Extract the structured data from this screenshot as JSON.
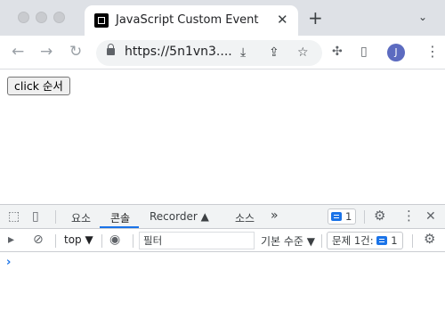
{
  "browser": {
    "tab": {
      "title": "JavaScript Custom Event",
      "close_glyph": "✕",
      "favicon": "page-favicon-icon"
    },
    "new_tab_glyph": "+",
    "tab_menu_glyph": "⌄",
    "toolbar": {
      "back_glyph": "←",
      "forward_glyph": "→",
      "reload_glyph": "↻",
      "url": "https://5n1vn3....",
      "install_glyph": "⤓",
      "share_glyph": "⇪",
      "bookmark_glyph": "☆",
      "extensions_glyph": "✣",
      "sidepanel_glyph": "▯",
      "profile_initial": "J",
      "profile_color": "#5c6bc0",
      "menu_glyph": "⋮"
    }
  },
  "page": {
    "button_label": "click 순서"
  },
  "devtools": {
    "inspect_glyph": "⬚",
    "device_glyph": "▯",
    "tabs": [
      {
        "label": "요소",
        "active": false
      },
      {
        "label": "콘솔",
        "active": true
      },
      {
        "label": "Recorder ▲",
        "active": false
      },
      {
        "label": "소스",
        "active": false
      }
    ],
    "more_tabs_glyph": "»",
    "issues_badge_count": "1",
    "settings_glyph": "⚙",
    "kebab_glyph": "⋮",
    "close_glyph": "✕",
    "console_bar": {
      "sidebar_glyph": "▸",
      "clear_glyph": "⊘",
      "context": "top ▼",
      "eye_glyph": "◉",
      "filter_placeholder": "필터",
      "levels": "기본 수준 ▼",
      "issues_label": "문제 1건:",
      "issues_count": "1",
      "settings_glyph": "⚙"
    },
    "prompt_glyph": "›",
    "accent_color": "#1a73e8"
  }
}
